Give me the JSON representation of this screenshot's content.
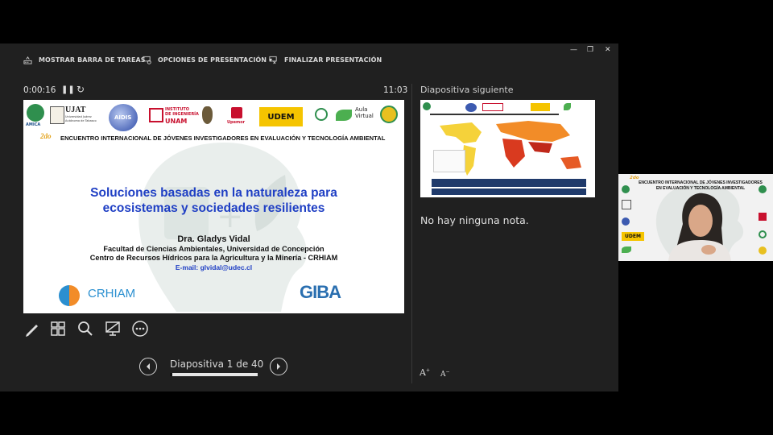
{
  "toolbar": {
    "taskbar_label": "MOSTRAR BARRA DE TAREAS",
    "options_label": "OPCIONES DE PRESENTACIÓN ▾",
    "end_label": "FINALIZAR PRESENTACIÓN"
  },
  "timer": {
    "elapsed": "0:00:16",
    "clock": "11:03"
  },
  "current_slide": {
    "event_year": "2do",
    "event_title": "ENCUENTRO INTERNACIONAL DE JÓVENES INVESTIGADORES EN EVALUACIÓN Y TECNOLOGÍA AMBIENTAL",
    "logos": {
      "amica": "AMICA",
      "ujat": "UJAT",
      "ujat_sub1": "Universidad Juárez",
      "ujat_sub2": "Autónoma de Tabasco",
      "aidis": "AIDIS",
      "instituto1": "INSTITUTO",
      "instituto2": "DE INGENIERÍA",
      "unam": "UNAM",
      "upemor": "Upemor",
      "udem": "UDEM",
      "aula1": "Aula",
      "aula2": "Virtual",
      "crhiam": "CRHIAM",
      "giba": "GIBA"
    },
    "title_line1": "Soluciones basadas en la naturaleza para",
    "title_line2": "ecosistemas y sociedades resilientes",
    "author": "Dra. Gladys Vidal",
    "affiliation1": "Facultad de Ciencias Ambientales, Universidad de Concepción",
    "affiliation2": "Centro de Recursos Hídricos para la Agricultura y la Minería - CRHIAM",
    "email": "E-mail: glvidal@udec.cl"
  },
  "next_panel": {
    "label": "Diapositiva siguiente",
    "notes": "No hay ninguna nota."
  },
  "navigation": {
    "counter": "Diapositiva 1 de 40",
    "progress": 0.025
  },
  "webcam": {
    "event_year": "2do",
    "event_title": "ENCUENTRO INTERNACIONAL DE JÓVENES INVESTIGADORES EN EVALUACIÓN Y TECNOLOGÍA AMBIENTAL",
    "udem": "UDEM"
  },
  "colors": {
    "app_bg": "#202020",
    "slide_title": "#1f3fc4",
    "udem_yellow": "#f5c400",
    "unam_red": "#c8102e"
  }
}
